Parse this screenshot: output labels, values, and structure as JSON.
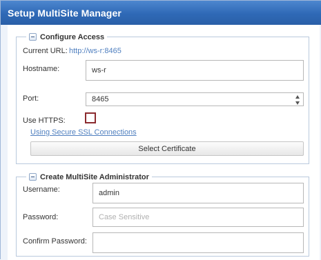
{
  "window": {
    "title": "Setup MultiSite Manager"
  },
  "configure_access": {
    "legend": "Configure Access",
    "current_url_label": "Current URL:",
    "current_url_value": "http://ws-r:8465",
    "hostname_label": "Hostname:",
    "hostname_value": "ws-r",
    "port_label": "Port:",
    "port_value": "8465",
    "use_https_label": "Use HTTPS:",
    "use_https_checked": false,
    "ssl_link": "Using Secure SSL Connections",
    "select_certificate_button": "Select Certificate"
  },
  "create_admin": {
    "legend": "Create MultiSite Administrator",
    "username_label": "Username:",
    "username_value": "admin",
    "password_label": "Password:",
    "password_placeholder": "Case Sensitive",
    "confirm_password_label": "Confirm Password:",
    "confirm_password_value": ""
  },
  "colors": {
    "title_bar": "#2f69b6",
    "link": "#4f7fbf",
    "checkbox_border": "#8b2a2e"
  }
}
